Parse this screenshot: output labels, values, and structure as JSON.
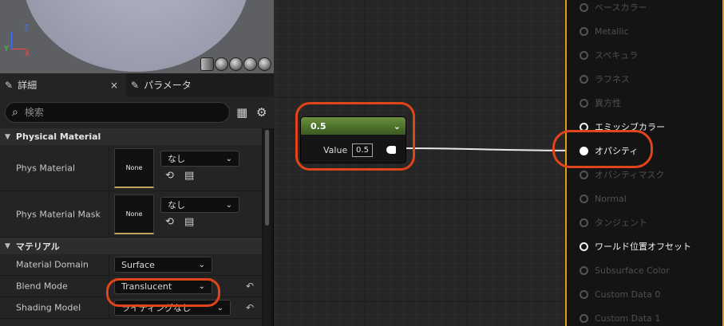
{
  "viewport": {
    "axis_z": "Z",
    "axis_x": "X",
    "axis_y": "Y",
    "preview_shapes": [
      "cylinder-icon",
      "sphere-icon",
      "plane-icon",
      "cube-icon",
      "teapot-icon"
    ]
  },
  "tabs": [
    {
      "label": "詳細",
      "icon": "details-icon",
      "active": true,
      "close": "×"
    },
    {
      "label": "パラメータ",
      "icon": "parameters-icon",
      "active": false
    }
  ],
  "search": {
    "placeholder": "検索"
  },
  "toolbar": {
    "grid_icon": "table-icon",
    "settings_icon": "gear-icon"
  },
  "categories": [
    {
      "title": "Physical Material",
      "rows": [
        {
          "label": "Phys Material",
          "thumb": "None",
          "dropdown": "なし"
        },
        {
          "label": "Phys Material Mask",
          "thumb": "None",
          "dropdown": "なし"
        }
      ]
    },
    {
      "title": "マテリアル",
      "rows": [
        {
          "label": "Material Domain",
          "value": "Surface"
        },
        {
          "label": "Blend Mode",
          "value": "Translucent"
        },
        {
          "label": "Shading Model",
          "value": "ライティングなし"
        }
      ]
    }
  ],
  "constant_node": {
    "title": "0.5",
    "value_label": "Value",
    "value": "0.5"
  },
  "result_pins": [
    {
      "label": "ベースカラー",
      "state": "off"
    },
    {
      "label": "Metallic",
      "state": "off"
    },
    {
      "label": "スペキュラ",
      "state": "off"
    },
    {
      "label": "ラフネス",
      "state": "off"
    },
    {
      "label": "異方性",
      "state": "off"
    },
    {
      "label": "エミッシブカラー",
      "state": "on"
    },
    {
      "label": "オパシティ",
      "state": "connected"
    },
    {
      "label": "オパシティマスク",
      "state": "off"
    },
    {
      "label": "Normal",
      "state": "off"
    },
    {
      "label": "タンジェント",
      "state": "off"
    },
    {
      "label": "ワールド位置オフセット",
      "state": "on"
    },
    {
      "label": "Subsurface Color",
      "state": "off"
    },
    {
      "label": "Custom Data 0",
      "state": "off"
    },
    {
      "label": "Custom Data 1",
      "state": "off"
    }
  ],
  "colors": {
    "highlight": "#e0441a",
    "result_border": "#e59a1a",
    "constant_header": "#5b7f34"
  }
}
